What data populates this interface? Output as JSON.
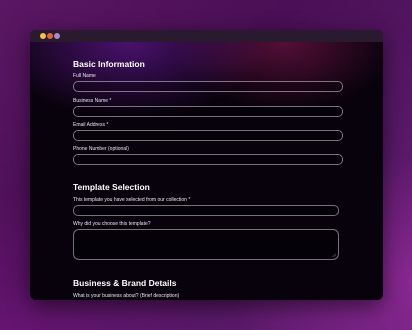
{
  "window": {
    "controls": [
      {
        "name": "close",
        "color": "#f5c242"
      },
      {
        "name": "minimize",
        "color": "#e0663a"
      },
      {
        "name": "maximize",
        "color": "#a98cc4"
      }
    ]
  },
  "form": {
    "basic": {
      "heading": "Basic Information",
      "full_name_label": "Full Name",
      "business_name_label": "Business Name *",
      "email_label": "Email Address *",
      "phone_label": "Phone Number (optional)"
    },
    "template": {
      "heading": "Template Selection",
      "selected_label": "This template you have selected from our collection *",
      "why_label": "Why did you choose this template?"
    },
    "business": {
      "heading": "Business & Brand Details",
      "about_label": "What is your business about? (Brief description)"
    }
  }
}
